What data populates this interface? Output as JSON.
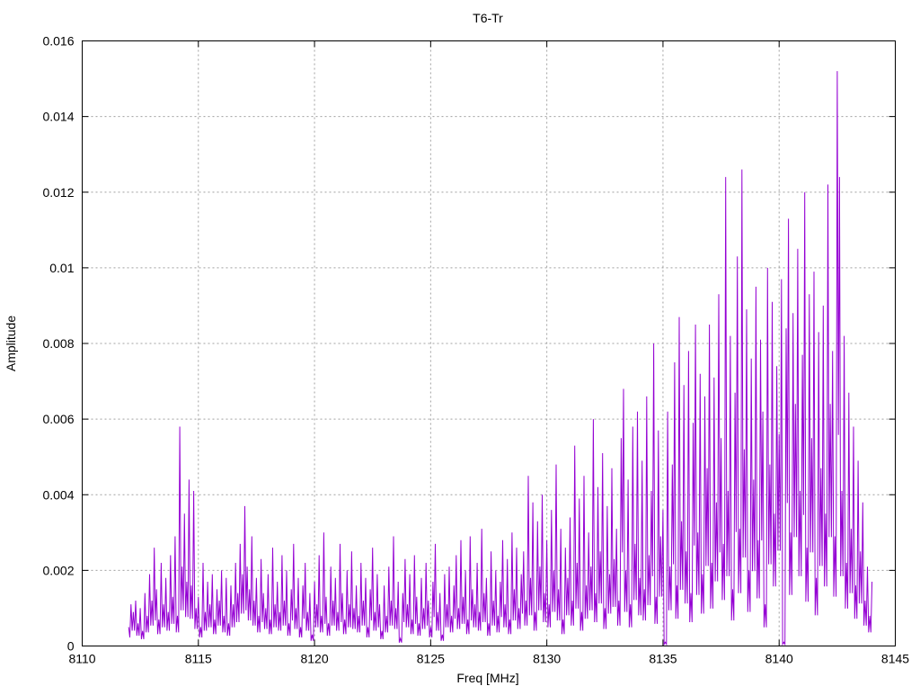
{
  "chart_data": {
    "type": "line",
    "title": "T6-Tr",
    "xlabel": "Freq [MHz]",
    "ylabel": "Amplitude",
    "xlim": [
      8110,
      8145
    ],
    "ylim": [
      0,
      0.016
    ],
    "xticks": [
      "8110",
      "8115",
      "8120",
      "8125",
      "8130",
      "8135",
      "8140",
      "8145"
    ],
    "yticks": [
      "0",
      "0.002",
      "0.004",
      "0.006",
      "0.008",
      "0.01",
      "0.012",
      "0.014",
      "0.016"
    ],
    "xtick_values": [
      8110,
      8115,
      8120,
      8125,
      8130,
      8135,
      8140,
      8145
    ],
    "ytick_values": [
      0,
      0.002,
      0.004,
      0.006,
      0.008,
      0.01,
      0.012,
      0.014,
      0.016
    ],
    "grid": true,
    "series": [
      {
        "name": "T6-Tr",
        "color": "#9400d3",
        "x_start": 8112.0,
        "x_step": 0.1,
        "values": [
          0.0005,
          0.0011,
          0.0009,
          0.0012,
          0.0006,
          0.001,
          0.0004,
          0.0014,
          0.0008,
          0.0019,
          0.0012,
          0.0026,
          0.0015,
          0.0007,
          0.0022,
          0.0011,
          0.0018,
          0.0009,
          0.0024,
          0.0013,
          0.0029,
          0.0008,
          0.0058,
          0.0021,
          0.0035,
          0.0017,
          0.0044,
          0.0016,
          0.0041,
          0.001,
          0.0013,
          0.0005,
          0.0022,
          0.0009,
          0.0017,
          0.0011,
          0.0019,
          0.0007,
          0.0015,
          0.0012,
          0.002,
          0.0008,
          0.0018,
          0.0006,
          0.0016,
          0.0011,
          0.0022,
          0.0014,
          0.0027,
          0.0019,
          0.0037,
          0.0021,
          0.0015,
          0.0029,
          0.0012,
          0.0018,
          0.0008,
          0.0023,
          0.0014,
          0.001,
          0.0019,
          0.0007,
          0.0026,
          0.0011,
          0.0017,
          0.0009,
          0.0024,
          0.0012,
          0.002,
          0.0006,
          0.0015,
          0.0027,
          0.001,
          0.0018,
          0.0005,
          0.0016,
          0.0022,
          0.0009,
          0.0014,
          0.0003,
          0.0017,
          0.0011,
          0.0024,
          0.0008,
          0.003,
          0.0013,
          0.0006,
          0.0021,
          0.0012,
          0.0018,
          0.0009,
          0.0027,
          0.0014,
          0.0007,
          0.002,
          0.0011,
          0.0025,
          0.001,
          0.0016,
          0.0008,
          0.0022,
          0.0012,
          0.0018,
          0.0005,
          0.0015,
          0.0026,
          0.0009,
          0.0019,
          0.0011,
          0.0004,
          0.0016,
          0.0008,
          0.0021,
          0.0012,
          0.0029,
          0.001,
          0.0017,
          0.0002,
          0.0014,
          0.0023,
          0.0011,
          0.0019,
          0.0007,
          0.0024,
          0.0013,
          0.0006,
          0.0018,
          0.001,
          0.0022,
          0.0012,
          0.0005,
          0.0017,
          0.0027,
          0.0009,
          0.0014,
          0.0003,
          0.0019,
          0.0011,
          0.0021,
          0.0008,
          0.0016,
          0.0024,
          0.001,
          0.0028,
          0.0013,
          0.002,
          0.0007,
          0.0029,
          0.0015,
          0.0011,
          0.0022,
          0.0009,
          0.0031,
          0.0014,
          0.0018,
          0.0006,
          0.0025,
          0.0012,
          0.002,
          0.0008,
          0.0017,
          0.0028,
          0.0011,
          0.0023,
          0.0007,
          0.003,
          0.0015,
          0.0026,
          0.001,
          0.0019,
          0.0025,
          0.0012,
          0.0045,
          0.0018,
          0.0038,
          0.0009,
          0.0033,
          0.0021,
          0.004,
          0.0014,
          0.0028,
          0.0011,
          0.0036,
          0.002,
          0.0048,
          0.0015,
          0.0031,
          0.0007,
          0.0026,
          0.0018,
          0.0034,
          0.0012,
          0.0053,
          0.0022,
          0.0039,
          0.0009,
          0.0045,
          0.0016,
          0.003,
          0.0021,
          0.006,
          0.0014,
          0.0042,
          0.0025,
          0.0051,
          0.001,
          0.0037,
          0.0019,
          0.0047,
          0.0023,
          0.0031,
          0.0012,
          0.0055,
          0.0068,
          0.002,
          0.0044,
          0.0011,
          0.0058,
          0.0027,
          0.0062,
          0.0018,
          0.0049,
          0.0015,
          0.0066,
          0.0024,
          0.0041,
          0.008,
          0.0013,
          0.0057,
          0.0029,
          0.0036,
          0.0001,
          0.0062,
          0.0021,
          0.0048,
          0.0075,
          0.0016,
          0.0087,
          0.0033,
          0.0069,
          0.0025,
          0.0078,
          0.0014,
          0.0059,
          0.0085,
          0.003,
          0.0072,
          0.0019,
          0.0066,
          0.0047,
          0.0085,
          0.0022,
          0.0071,
          0.0038,
          0.0093,
          0.0055,
          0.0027,
          0.0124,
          0.0041,
          0.0082,
          0.0015,
          0.0067,
          0.0103,
          0.0031,
          0.0126,
          0.0052,
          0.0089,
          0.002,
          0.0076,
          0.0044,
          0.0095,
          0.0028,
          0.0081,
          0.0062,
          0.0011,
          0.01,
          0.0048,
          0.0091,
          0.0035,
          0.0074,
          0.0056,
          0.0097,
          0.0001,
          0.0084,
          0.0113,
          0.003,
          0.0088,
          0.0064,
          0.0105,
          0.0041,
          0.0077,
          0.012,
          0.0026,
          0.0093,
          0.0055,
          0.0099,
          0.0018,
          0.0083,
          0.0047,
          0.009,
          0.0035,
          0.0122,
          0.0064,
          0.0078,
          0.0029,
          0.0152,
          0.0124,
          0.0041,
          0.0082,
          0.0022,
          0.0067,
          0.0031,
          0.0058,
          0.0016,
          0.0049,
          0.0025,
          0.0038,
          0.0012,
          0.0021,
          0.0008,
          0.0017
        ]
      }
    ]
  }
}
